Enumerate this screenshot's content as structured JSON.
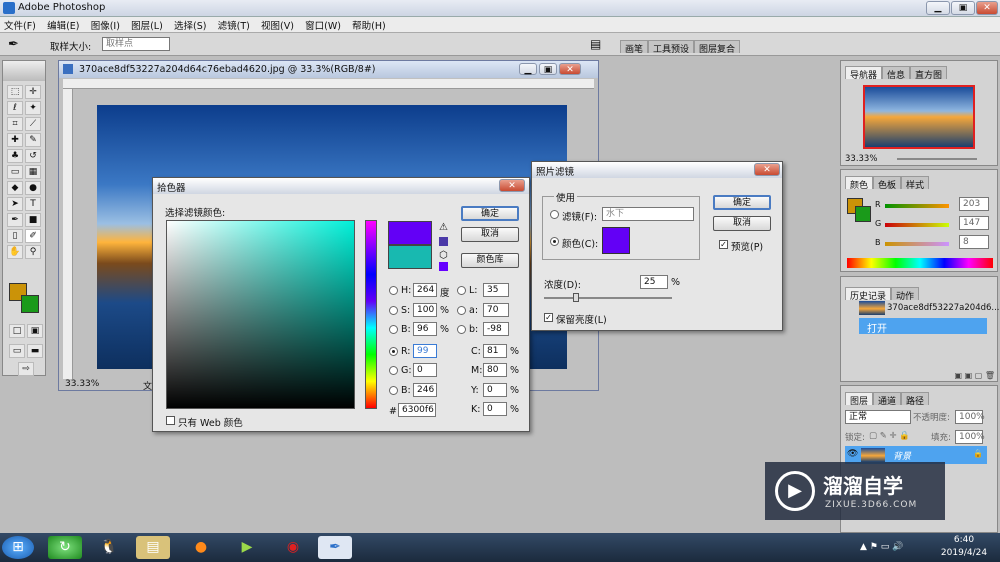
{
  "app": {
    "title": "Adobe Photoshop"
  },
  "window_buttons": {
    "minimize": "▁",
    "restore": "▣",
    "close": "✕"
  },
  "menu": [
    "文件(F)",
    "编辑(E)",
    "图像(I)",
    "图层(L)",
    "选择(S)",
    "滤镜(T)",
    "视图(V)",
    "窗口(W)",
    "帮助(H)"
  ],
  "options": {
    "sample_label": "取样大小:",
    "sample_value": "取样点",
    "tabs": [
      "画笔",
      "工具预设",
      "图层复合"
    ]
  },
  "doc": {
    "title": "370ace8df53227a204d64c76ebad4620.jpg @ 33.3%(RGB/8#)",
    "zoom": "33.33%",
    "status": "文"
  },
  "picker": {
    "title": "拾色器",
    "label": "选择滤镜颜色:",
    "ok": "确定",
    "cancel": "取消",
    "library": "颜色库",
    "web_only": "只有 Web 颜色",
    "H": "264",
    "H_unit": "度",
    "S": "100",
    "S_unit": "%",
    "B": "96",
    "B_unit": "%",
    "R": "99",
    "G": "0",
    "Bv": "246",
    "L": "35",
    "a": "70",
    "b": "-98",
    "C": "81",
    "M": "80",
    "Y": "0",
    "K": "0",
    "pct": "%",
    "hex": "6300f6",
    "hexlabel": "#",
    "lab": {
      "H": "H:",
      "S": "S:",
      "B": "B:",
      "R": "R:",
      "G": "G:",
      "Bb": "B:",
      "L": "L:",
      "a": "a:",
      "b": "b:",
      "C": "C:",
      "M": "M:",
      "Y": "Y:",
      "K": "K:"
    }
  },
  "photofilter": {
    "title": "照片滤镜",
    "group": "使用",
    "filter_label": "滤镜(F):",
    "filter_value": "水下",
    "color_label": "颜色(C):",
    "ok": "确定",
    "cancel": "取消",
    "preview": "预览(P)",
    "density_label": "浓度(D):",
    "density": "25",
    "density_unit": "%",
    "preserve": "保留亮度(L)",
    "swatch": "#6300f6"
  },
  "navigator": {
    "tabs": [
      "导航器",
      "信息",
      "直方图"
    ],
    "zoom": "33.33%"
  },
  "color_panel": {
    "tabs": [
      "颜色",
      "色板",
      "样式"
    ],
    "R_label": "R",
    "G_label": "G",
    "B_label": "B",
    "R": "203",
    "G": "147",
    "B": "8"
  },
  "history": {
    "tabs": [
      "历史记录",
      "动作"
    ],
    "snapshot": "370ace8df53227a204d6...",
    "item": "打开"
  },
  "layers": {
    "tabs": [
      "图层",
      "通道",
      "路径"
    ],
    "mode": "正常",
    "opacity_label": "不透明度:",
    "opacity": "100%",
    "lock_label": "锁定:",
    "fill_label": "填充:",
    "fill": "100%",
    "layer": "背景"
  },
  "watermark": {
    "name": "溜溜自学",
    "url": "ZIXUE.3D66.COM"
  },
  "taskbar": {
    "time": "6:40",
    "date": "2019/4/24"
  },
  "colors": {
    "selected": "#6300f6",
    "fg": "#cb9308",
    "bg": "#1a9a1a",
    "sel_blue": "#4ea3ef"
  }
}
